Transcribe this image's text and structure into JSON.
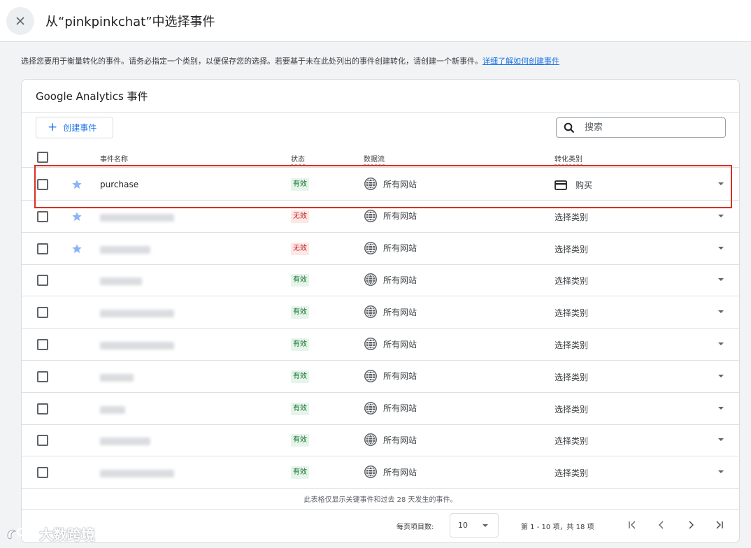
{
  "header": {
    "title": "从“pinkpinkchat”中选择事件"
  },
  "intro": {
    "text": "选择您要用于衡量转化的事件。请务必指定一个类别，以便保存您的选择。若要基于未在此处列出的事件创建转化，请创建一个新事件。",
    "link": "详细了解如何创建事件"
  },
  "card": {
    "title": "Google Analytics 事件",
    "create_button": "创建事件",
    "search_placeholder": "搜索"
  },
  "columns": {
    "name": "事件名称",
    "status": "状态",
    "stream": "数据流",
    "category": "转化类别"
  },
  "rows": [
    {
      "name": "purchase",
      "starred": true,
      "status": "有效",
      "stream": "所有网站",
      "category": "购买"
    },
    {
      "name": "",
      "starred": true,
      "status": "无效",
      "stream": "所有网站",
      "category": "选择类别"
    },
    {
      "name": "",
      "starred": true,
      "status": "无效",
      "stream": "所有网站",
      "category": "选择类别"
    },
    {
      "name": "",
      "starred": false,
      "status": "有效",
      "stream": "所有网站",
      "category": "选择类别"
    },
    {
      "name": "",
      "starred": false,
      "status": "有效",
      "stream": "所有网站",
      "category": "选择类别"
    },
    {
      "name": "",
      "starred": false,
      "status": "有效",
      "stream": "所有网站",
      "category": "选择类别"
    },
    {
      "name": "",
      "starred": false,
      "status": "有效",
      "stream": "所有网站",
      "category": "选择类别"
    },
    {
      "name": "",
      "starred": false,
      "status": "有效",
      "stream": "所有网站",
      "category": "选择类别"
    },
    {
      "name": "",
      "starred": false,
      "status": "有效",
      "stream": "所有网站",
      "category": "选择类别"
    },
    {
      "name": "",
      "starred": false,
      "status": "有效",
      "stream": "所有网站",
      "category": "选择类别"
    }
  ],
  "footer": {
    "note": "此表格仅显示关键事件和过去 28 天发生的事件。",
    "per_page_label": "每页项目数:",
    "per_page_value": "10",
    "range": "第 1 - 10 项，共 18 项"
  },
  "watermark": "大数跨境",
  "colors": {
    "accent": "#1a73e8",
    "star": "#8ab4f8",
    "highlight": "#d93025",
    "valid_bg": "#e6f4ea",
    "valid_text": "#137333",
    "invalid_bg": "#fce8e6",
    "invalid_text": "#c5221f"
  },
  "icons": [
    "close-icon",
    "plus-icon",
    "search-icon",
    "star-icon",
    "globe-icon",
    "credit-card-icon",
    "chevron-down-icon",
    "first-page-icon",
    "prev-page-icon",
    "next-page-icon",
    "last-page-icon"
  ]
}
